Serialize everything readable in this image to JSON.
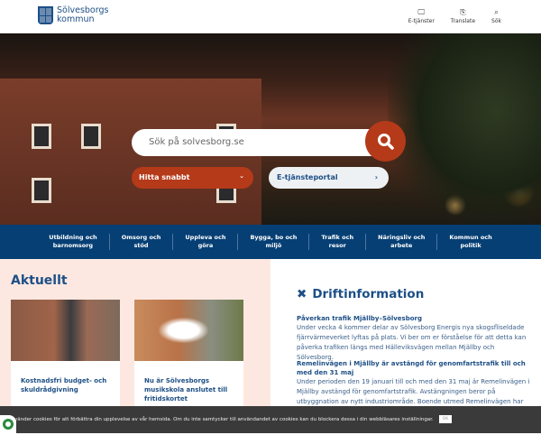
{
  "header": {
    "logo_line1": "Sölvesborgs",
    "logo_line2": "kommun",
    "tools": [
      {
        "icon": "monitor-icon",
        "label": "E-tjänster"
      },
      {
        "icon": "translate-icon",
        "label": "Translate"
      },
      {
        "icon": "search-icon",
        "label": "Sök"
      }
    ]
  },
  "hero": {
    "search_placeholder": "Sök på solvesborg.se",
    "quick_label": "Hitta snabbt",
    "portal_label": "E-tjänsteportal"
  },
  "nav": [
    {
      "l1": "Utbildning och",
      "l2": "barnomsorg"
    },
    {
      "l1": "Omsorg och",
      "l2": "stöd"
    },
    {
      "l1": "Uppleva och",
      "l2": "göra"
    },
    {
      "l1": "Bygga, bo och",
      "l2": "miljö"
    },
    {
      "l1": "Trafik och",
      "l2": "resor"
    },
    {
      "l1": "Näringsliv och",
      "l2": "arbete"
    },
    {
      "l1": "Kommun och",
      "l2": "politik"
    }
  ],
  "news": {
    "title": "Aktuellt",
    "cards": [
      {
        "title": "Kostnadsfri budget- och skuldrådgivning"
      },
      {
        "title": "Nu är Sölvesborgs musikskola anslutet till fritidskortet"
      }
    ]
  },
  "drift": {
    "title": "Driftinformation",
    "entries": [
      {
        "title": "Påverkan trafik Mjällby–Sölvesborg",
        "body": "Under vecka 4 kommer delar av Sölvesborg Energis nya skogsfliseldade fjärrvärmeverket lyftas på plats. Vi ber om er förståelse för att detta kan påverka trafiken längs med Hälleviksvägen mellan Mjällby och Sölvesborg."
      },
      {
        "title": "Remelinvägen i Mjällby är avstängd för genomfartstrafik till och med den 31 maj",
        "body": "Under perioden den 19 januari till och med den 31 maj är Remelinvägen i Mjällby avstängd för genomfartstrafik. Avstängningen beror på utbyggnation av nytt industriområde. Boende utmed Remelinvägen har"
      }
    ]
  },
  "cookie": {
    "text": "vänder cookies för att förbättra din upplevelse av vår hemsida. Om du inte samtycker till användandet av cookies kan du blockera dessa i din webbläsares inställningar.",
    "ok": "OK"
  }
}
